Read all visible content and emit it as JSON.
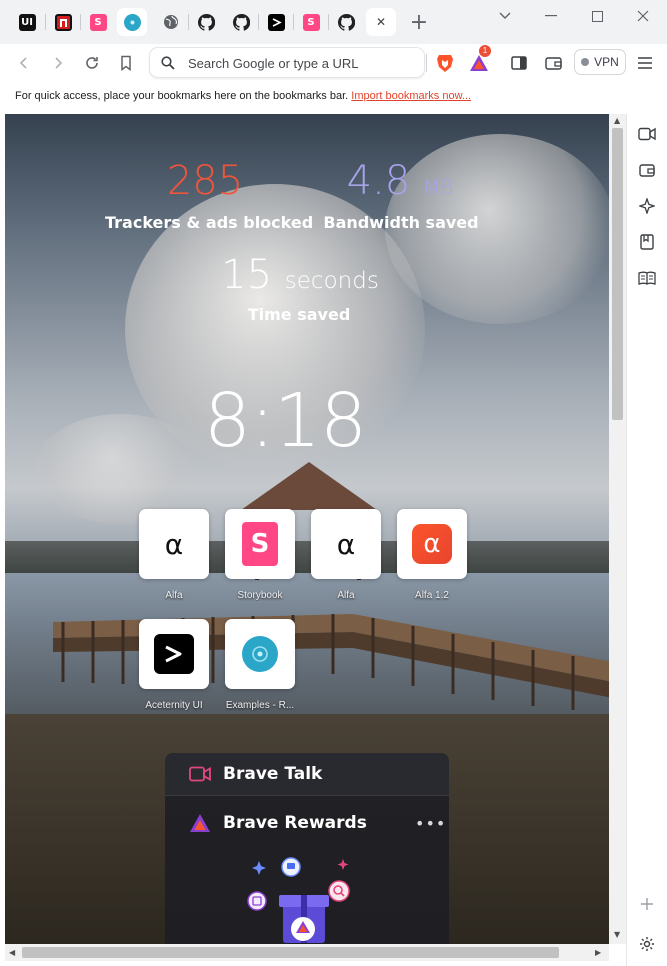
{
  "tabs": [
    {
      "icon": "ui-logo-icon",
      "text": "UI"
    },
    {
      "icon": "n-logo-icon",
      "text": ""
    },
    {
      "icon": "storybook-icon",
      "text": "S"
    },
    {
      "icon": "react-icon",
      "text": ""
    },
    {
      "icon": "globe-icon",
      "text": ""
    },
    {
      "icon": "github-icon",
      "text": ""
    },
    {
      "icon": "github-icon",
      "text": ""
    },
    {
      "icon": "aceternity-icon",
      "text": ""
    },
    {
      "icon": "storybook-icon",
      "text": "S"
    },
    {
      "icon": "github-icon",
      "text": ""
    },
    {
      "icon": "close-icon",
      "text": "✕"
    }
  ],
  "new_tab_label": "+",
  "omnibox": {
    "placeholder": "Search Google or type a URL"
  },
  "rewards_badge": "1",
  "vpn_label": "VPN",
  "bookmarks_bar": {
    "message": "For quick access, place your bookmarks here on the bookmarks bar.",
    "link": "Import bookmarks now..."
  },
  "stats": {
    "trackers_value": "285",
    "trackers_label": "Trackers & ads blocked",
    "bandwidth_value": "4.8",
    "bandwidth_unit": "MB",
    "bandwidth_label": "Bandwidth saved",
    "time_value": "15",
    "time_unit": "seconds",
    "time_label": "Time saved"
  },
  "clock": "8:18",
  "top_sites": [
    {
      "label": "Alfa",
      "glyph": "α",
      "style": "alpha-plain"
    },
    {
      "label": "Storybook",
      "glyph": "S",
      "style": "storybook"
    },
    {
      "label": "Alfa",
      "glyph": "α",
      "style": "alpha-plain"
    },
    {
      "label": "Alfa 1.2",
      "glyph": "α",
      "style": "alpha-orange"
    },
    {
      "label": "Aceternity UI",
      "glyph": ">",
      "style": "aceternity"
    },
    {
      "label": "Examples - R...",
      "glyph": "",
      "style": "examples"
    }
  ],
  "cards": {
    "talk_title": "Brave Talk",
    "rewards_title": "Brave Rewards",
    "more": "•••"
  },
  "colors": {
    "trackers": "#f0553a",
    "bandwidth": "#a8a3e8",
    "brave_orange": "#fb542b",
    "talk_pink": "#e1477c"
  }
}
